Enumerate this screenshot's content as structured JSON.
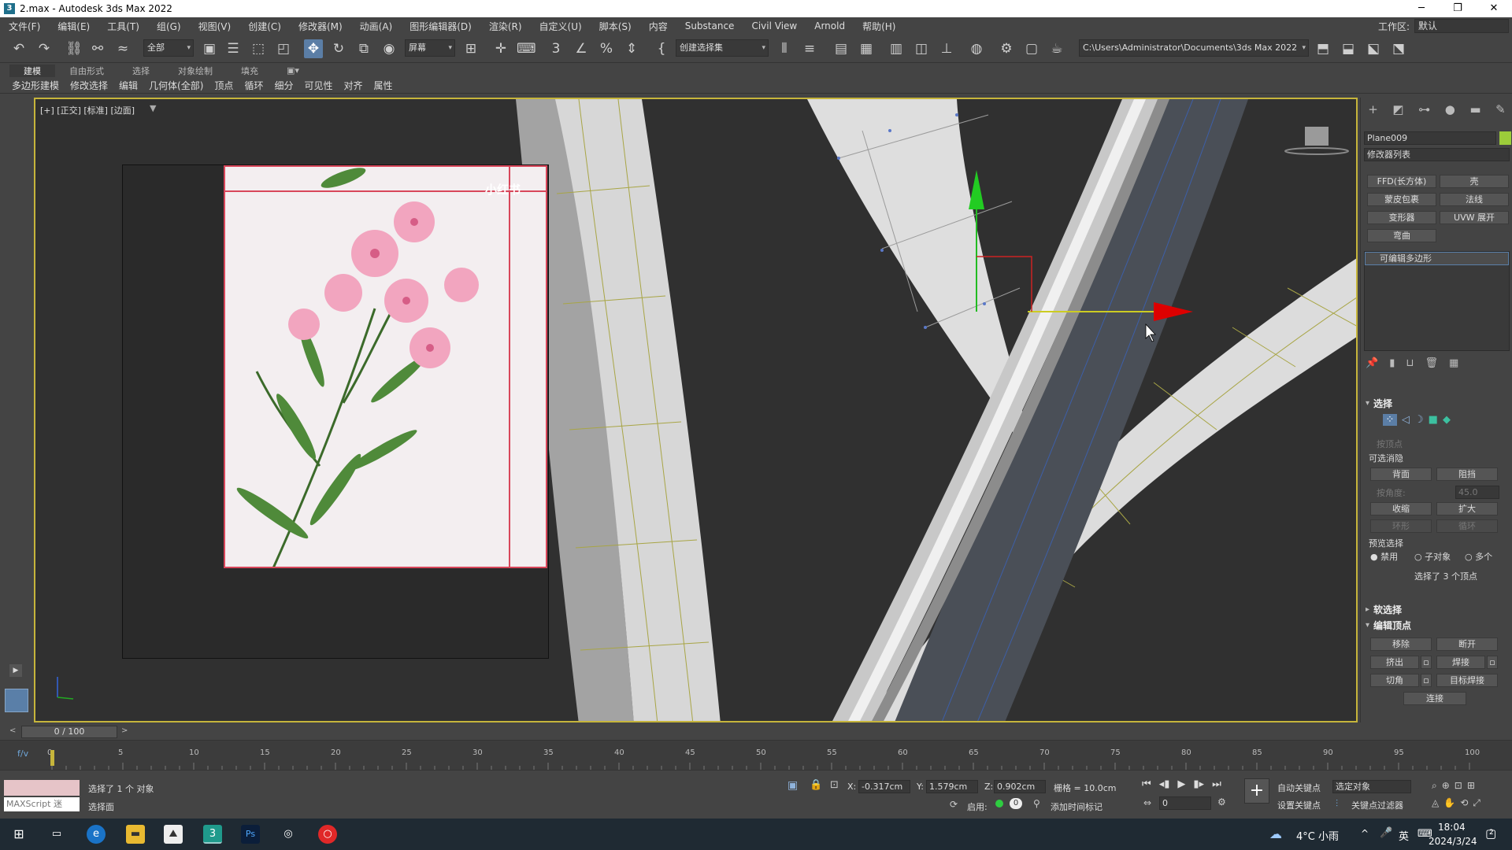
{
  "window": {
    "title": "2.max - Autodesk 3ds Max 2022",
    "minimize": "─",
    "maximize": "❐",
    "close": "✕"
  },
  "menu": {
    "items": [
      "文件(F)",
      "编辑(E)",
      "工具(T)",
      "组(G)",
      "视图(V)",
      "创建(C)",
      "修改器(M)",
      "动画(A)",
      "图形编辑器(D)",
      "渲染(R)",
      "自定义(U)",
      "脚本(S)",
      "内容",
      "Substance",
      "Civil View",
      "Arnold",
      "帮助(H)"
    ],
    "workspace_label": "工作区:",
    "workspace_value": "默认"
  },
  "toolbar": {
    "filter_value": "全部",
    "ref_coord_value": "屏幕",
    "selset_value": "创建选择集",
    "project_path": "C:\\Users\\Administrator\\Documents\\3ds Max 2022"
  },
  "ribbon": {
    "tabs": [
      "建模",
      "自由形式",
      "选择",
      "对象绘制",
      "填充"
    ],
    "items": [
      "多边形建模",
      "修改选择",
      "编辑",
      "几何体(全部)",
      "顶点",
      "循环",
      "细分",
      "可见性",
      "对齐",
      "属性"
    ]
  },
  "viewport": {
    "label": "[+] [正交] [标准] [边面]",
    "ref_watermark": "小红书"
  },
  "cmdpanel": {
    "object_name": "Plane009",
    "object_color": "#9ccc3a",
    "modifier_list": "修改器列表",
    "mod_buttons": [
      "FFD(长方体)",
      "壳",
      "蒙皮包裹",
      "法线",
      "变形器",
      "UVW 展开",
      "弯曲"
    ],
    "stack_item": "可编辑多边形",
    "selection": {
      "title": "选择",
      "by_vertex": "按顶点",
      "ignore_backface": "可选消隐",
      "backface": "背面",
      "occluded": "阻挡",
      "by_angle": "按角度:",
      "angle_value": "45.0",
      "shrink": "收缩",
      "grow": "扩大",
      "ring": "环形",
      "loop": "循环",
      "preview_title": "预览选择",
      "preview_disable": "禁用",
      "preview_subobj": "子对象",
      "preview_multi": "多个",
      "status": "选择了 3 个顶点"
    },
    "soft_selection": "软选择",
    "edit_vertices": {
      "title": "编辑顶点",
      "remove": "移除",
      "break": "断开",
      "extrude": "挤出",
      "weld": "焊接",
      "chamfer": "切角",
      "target_weld": "目标焊接",
      "connect": "连接"
    }
  },
  "timeline": {
    "frame_display": "0 / 100",
    "ticks": [
      "0",
      "5",
      "10",
      "15",
      "20",
      "25",
      "30",
      "35",
      "40",
      "45",
      "50",
      "55",
      "60",
      "65",
      "70",
      "75",
      "80",
      "85",
      "90",
      "95",
      "100"
    ]
  },
  "status": {
    "maxscript": "MAXScript 迷",
    "selected": "选择了 1 个 对象",
    "prompt": "选择面",
    "x_label": "X:",
    "x_value": "-0.317cm",
    "y_label": "Y:",
    "y_value": "1.579cm",
    "z_label": "Z:",
    "z_value": "0.902cm",
    "grid": "栅格 = 10.0cm",
    "enable": "启用:",
    "add_time_tag": "添加时间标记",
    "auto_key": "自动关键点",
    "set_key": "设置关键点",
    "selected_obj": "选定对象",
    "key_filters": "关键点过滤器",
    "frame_value": "0"
  },
  "taskbar": {
    "weather": "4°C 小雨",
    "time": "18:04",
    "date": "2024/3/24",
    "ime": "英",
    "notification": "2"
  }
}
